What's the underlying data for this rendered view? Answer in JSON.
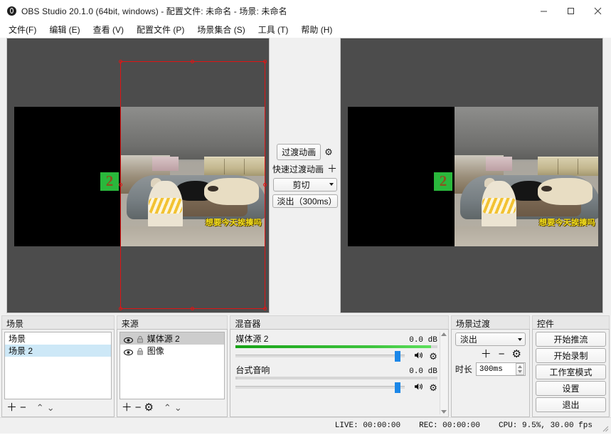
{
  "window": {
    "title": "OBS Studio 20.1.0 (64bit, windows) - 配置文件: 未命名 - 场景: 未命名",
    "logo": "obs-logo",
    "minimize": "–",
    "maximize": "□",
    "close": "×"
  },
  "menu": {
    "items": [
      {
        "label": "文件(F)"
      },
      {
        "label": "编辑 (E)"
      },
      {
        "label": "查看 (V)"
      },
      {
        "label": "配置文件 (P)"
      },
      {
        "label": "场景集合 (S)"
      },
      {
        "label": "工具 (T)"
      },
      {
        "label": "帮助 (H)"
      }
    ]
  },
  "preview": {
    "caption": "想要今天挨揍吗",
    "green_chip_text": "2",
    "selection_color": "#e01414"
  },
  "program": {
    "caption": "想要今天挨揍吗",
    "green_chip_text": "2"
  },
  "transition_center": {
    "transition_button": "过渡动画",
    "gear_icon": "gear-icon",
    "quick_transition_label": "快速过渡动画",
    "quick_transition_plus": "＋",
    "cut_combo": "剪切",
    "fade_combo": "淡出（300ms）"
  },
  "scenes": {
    "title": "场景",
    "items": [
      {
        "label": "场景",
        "selected": false
      },
      {
        "label": "场景 2",
        "selected": true
      }
    ],
    "toolbar": {
      "add": "＋",
      "remove": "−",
      "up": "⌃",
      "down": "⌄"
    }
  },
  "sources": {
    "title": "来源",
    "items": [
      {
        "label": "媒体源 2",
        "selected": true,
        "eye": "eye-icon",
        "lock": "lock-icon"
      },
      {
        "label": "图像",
        "selected": false,
        "eye": "eye-icon",
        "lock": "lock-icon"
      }
    ],
    "toolbar": {
      "add": "＋",
      "remove": "−",
      "properties": "gear-icon",
      "up": "⌃",
      "down": "⌄"
    }
  },
  "mixer": {
    "title": "混音器",
    "tracks": [
      {
        "name": "媒体源 2",
        "db": "0.0 dB",
        "meter_percent": 97,
        "volume_percent": 84,
        "mute_icon": "speaker-icon",
        "settings_icon": "gear-icon"
      },
      {
        "name": "台式音响",
        "db": "0.0 dB",
        "meter_percent": 0,
        "volume_percent": 84,
        "mute_icon": "speaker-icon",
        "settings_icon": "gear-icon"
      }
    ]
  },
  "scene_transitions": {
    "title": "场景过渡",
    "selected": "淡出",
    "add": "＋",
    "remove": "−",
    "properties": "gear-icon",
    "duration_label": "时长",
    "duration_value": "300ms"
  },
  "controls": {
    "title": "控件",
    "buttons": [
      {
        "label": "开始推流"
      },
      {
        "label": "开始录制"
      },
      {
        "label": "工作室模式"
      },
      {
        "label": "设置"
      },
      {
        "label": "退出"
      }
    ]
  },
  "status": {
    "live": "LIVE: 00:00:00",
    "rec": "REC: 00:00:00",
    "cpu": "CPU: 9.5%, 30.00 fps"
  }
}
